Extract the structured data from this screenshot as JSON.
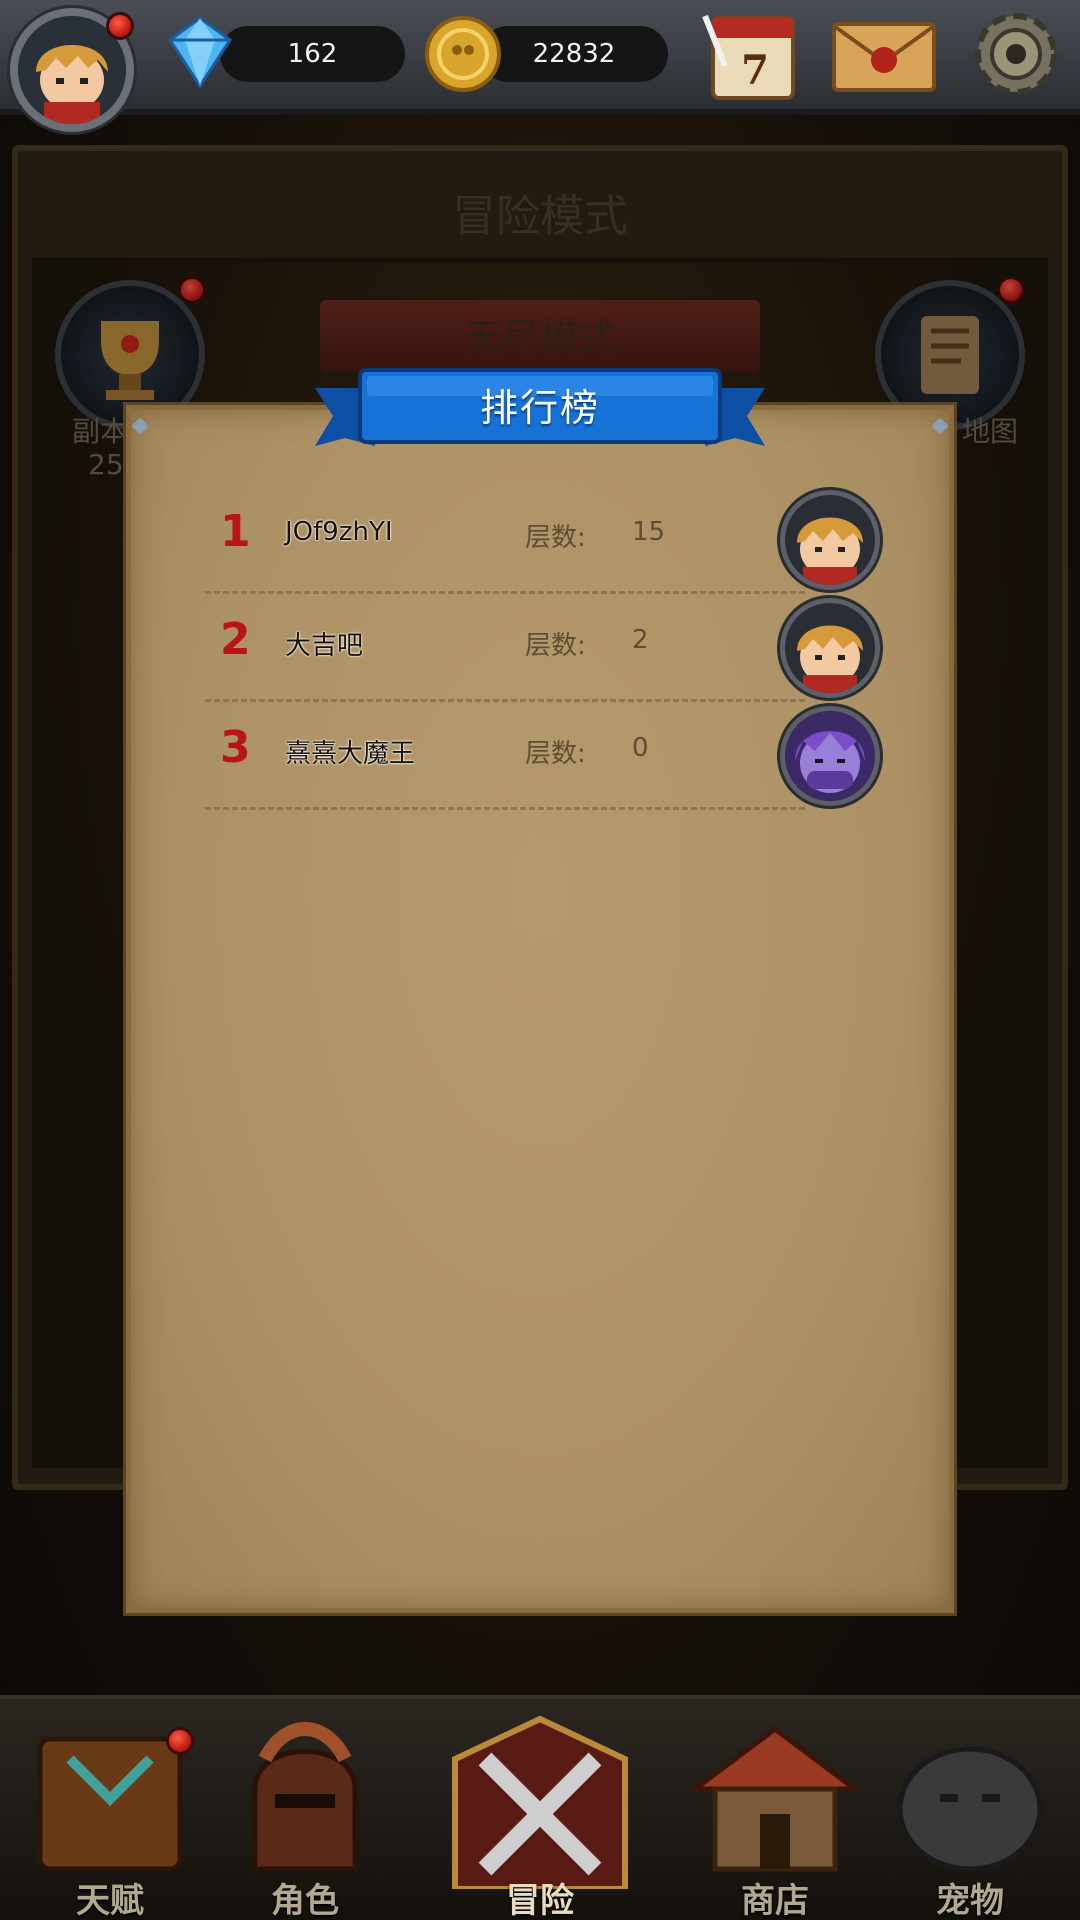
{
  "top_bar": {
    "gems": "162",
    "gold": "22832",
    "calendar_day": "7"
  },
  "background": {
    "mode_title": "冒险模式",
    "endless_title": "无尽模式",
    "left_label_1": "副本",
    "left_label_2": "25",
    "right_label": "地图"
  },
  "leaderboard": {
    "title": "排行榜",
    "rows": [
      {
        "rank": "1",
        "name": "JOf9zhYI",
        "layer_label": "层数:",
        "layer": "15"
      },
      {
        "rank": "2",
        "name": "大吉吧",
        "layer_label": "层数:",
        "layer": "2"
      },
      {
        "rank": "3",
        "name": "熹熹大魔王",
        "layer_label": "层数:",
        "layer": "0"
      }
    ]
  },
  "bottom_nav": {
    "items": [
      "天赋",
      "角色",
      "冒险",
      "商店",
      "宠物"
    ]
  },
  "colors": {
    "rank_red": "#b8141a",
    "ribbon_blue": "#1466c8",
    "parchment": "#b59a6e"
  }
}
